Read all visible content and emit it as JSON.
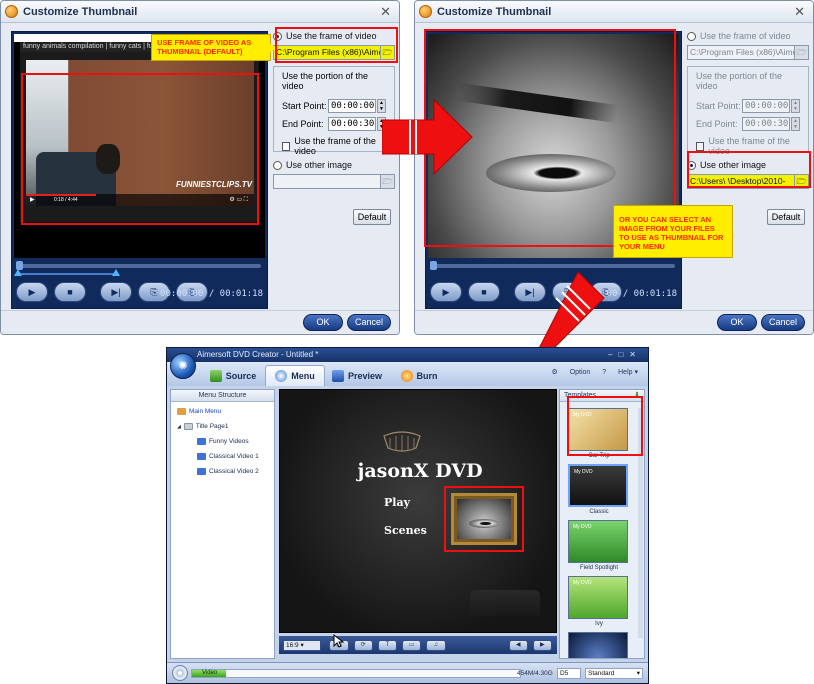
{
  "colors": {
    "accent_red": "#ee1010",
    "callout_yellow": "#ffee00",
    "callout_text": "#ff2b00",
    "app_navy": "#1f3a72"
  },
  "dialog_left": {
    "title": "Customize Thumbnail",
    "video_title": "funny animals compilation | funny cats | funny dogs | animals fails ...",
    "video_time": "0:18 / 4:44",
    "watermark": "FUNNIESTCLIPS.TV",
    "radio_frame_label": "Use the frame of video",
    "path_frame": "C:\\Program Files (x86)\\Aimersoft",
    "portion_label": "Use the portion of the video",
    "start_label": "Start Point:",
    "start_value": "00:00:00",
    "end_label": "End Point:",
    "end_value": "00:00:30",
    "check_frame_label": "Use the frame of the video",
    "radio_other_label": "Use other image",
    "path_other": "",
    "default_label": "Default",
    "time_readout": "00:00:00 / 00:01:18",
    "ok_label": "OK",
    "cancel_label": "Cancel",
    "callout": "USE FRAME OF VIDEO AS THUMBNAIL (DEFAULT)"
  },
  "dialog_right": {
    "title": "Customize Thumbnail",
    "radio_frame_label": "Use the frame of video",
    "path_frame": "C:\\Program Files (x86)\\Aimersoft",
    "portion_label": "Use the portion of the video",
    "start_label": "Start Point:",
    "start_value": "00:00:00",
    "end_label": "End Point:",
    "end_value": "00:00:30",
    "check_frame_label": "Use the frame of the video",
    "radio_other_label": "Use other image",
    "path_other": "C:\\Users\\        \\Desktop\\2010-",
    "default_label": "Default",
    "time_readout": "00:00:00 / 00:01:18",
    "ok_label": "OK",
    "cancel_label": "Cancel",
    "callout": "OR YOU CAN SELECT AN IMAGE FROM YOUR FILES TO USE AS THUMBNAIL FOR YOUR MENU"
  },
  "app": {
    "title": "Aimersoft DVD Creator - Untitled *",
    "tabs": [
      "Source",
      "Menu",
      "Preview",
      "Burn"
    ],
    "option_label": "Option",
    "help_label": "Help",
    "menu_structure_label": "Menu Structure",
    "tree": [
      "Main Menu",
      "Title Page1",
      "Funny Videos",
      "Classical Video 1",
      "Classical Video 2"
    ],
    "menu_title": "jasonX DVD",
    "menu_items": [
      "Play",
      "Scenes"
    ],
    "aspect": "16:9",
    "templates_label": "Templates",
    "templates": [
      "Car Trip",
      "Classic",
      "Field Spotlight",
      "Ivy",
      ""
    ],
    "template_badge": "My DVD",
    "capacity_label": "Video",
    "capacity_value": "454M/4.30G",
    "disc_type": "D5",
    "quality": "Standard"
  }
}
